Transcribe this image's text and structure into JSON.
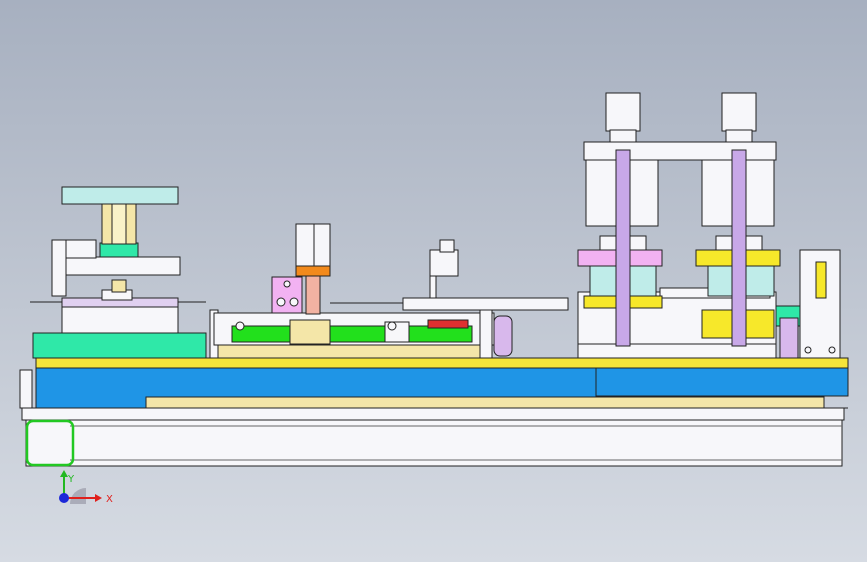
{
  "viewport": {
    "background_top": "#a7b0c0",
    "background_bottom": "#d6dbe3",
    "line_color": "#222222"
  },
  "colors": {
    "base_blue": "#1f95e6",
    "rail_yellow": "#f5e53a",
    "cream": "#f4e6a8",
    "white_part": "#f7f7fa",
    "cyan_cap": "#bfece9",
    "mint_block": "#2fe8a8",
    "green_cylinder": "#22e01c",
    "pink_block": "#f2b2f2",
    "yellow_block": "#f7e82a",
    "lilac_rod": "#c8a8e8",
    "orange_band": "#f28a1c"
  },
  "triad": {
    "x_axis_label": "X",
    "y_axis_label": "Y",
    "x_color": "#e0201c",
    "y_color": "#22b822",
    "z_color": "#1c28d8"
  }
}
